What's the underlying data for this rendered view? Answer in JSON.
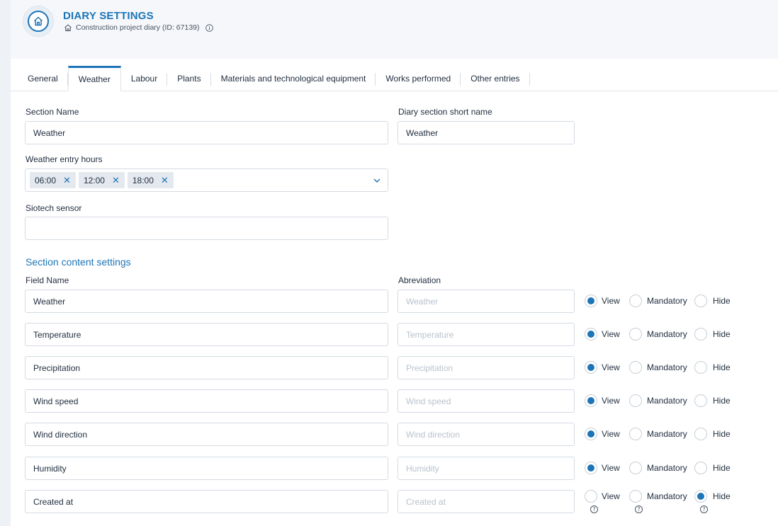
{
  "header": {
    "title": "DIARY SETTINGS",
    "subtitle": "Construction project diary (ID: 67139)"
  },
  "tabs": [
    {
      "label": "General",
      "active": false
    },
    {
      "label": "Weather",
      "active": true
    },
    {
      "label": "Labour",
      "active": false
    },
    {
      "label": "Plants",
      "active": false
    },
    {
      "label": "Materials and technological equipment",
      "active": false
    },
    {
      "label": "Works performed",
      "active": false
    },
    {
      "label": "Other entries",
      "active": false
    }
  ],
  "form": {
    "section_name_label": "Section Name",
    "section_name_value": "Weather",
    "short_name_label": "Diary section short name",
    "short_name_value": "Weather",
    "entry_hours_label": "Weather entry hours",
    "entry_hours": [
      "06:00",
      "12:00",
      "18:00"
    ],
    "sensor_label": "Siotech sensor",
    "sensor_value": ""
  },
  "content": {
    "title": "Section content settings",
    "field_name_header": "Field Name",
    "abbreviation_header": "Abreviation",
    "option_labels": [
      "View",
      "Mandatory",
      "Hide"
    ],
    "rows": [
      {
        "field": "Weather",
        "abbr_placeholder": "Weather",
        "selected": "View"
      },
      {
        "field": "Temperature",
        "abbr_placeholder": "Temperature",
        "selected": "View"
      },
      {
        "field": "Precipitation",
        "abbr_placeholder": "Precipitation",
        "selected": "View"
      },
      {
        "field": "Wind speed",
        "abbr_placeholder": "Wind speed",
        "selected": "View"
      },
      {
        "field": "Wind direction",
        "abbr_placeholder": "Wind direction",
        "selected": "View"
      },
      {
        "field": "Humidity",
        "abbr_placeholder": "Humidity",
        "selected": "View"
      },
      {
        "field": "Created at",
        "abbr_placeholder": "Created at",
        "selected": "Hide"
      }
    ]
  },
  "help_icon_glyph": "?",
  "colors": {
    "accent": "#1d75b7"
  }
}
